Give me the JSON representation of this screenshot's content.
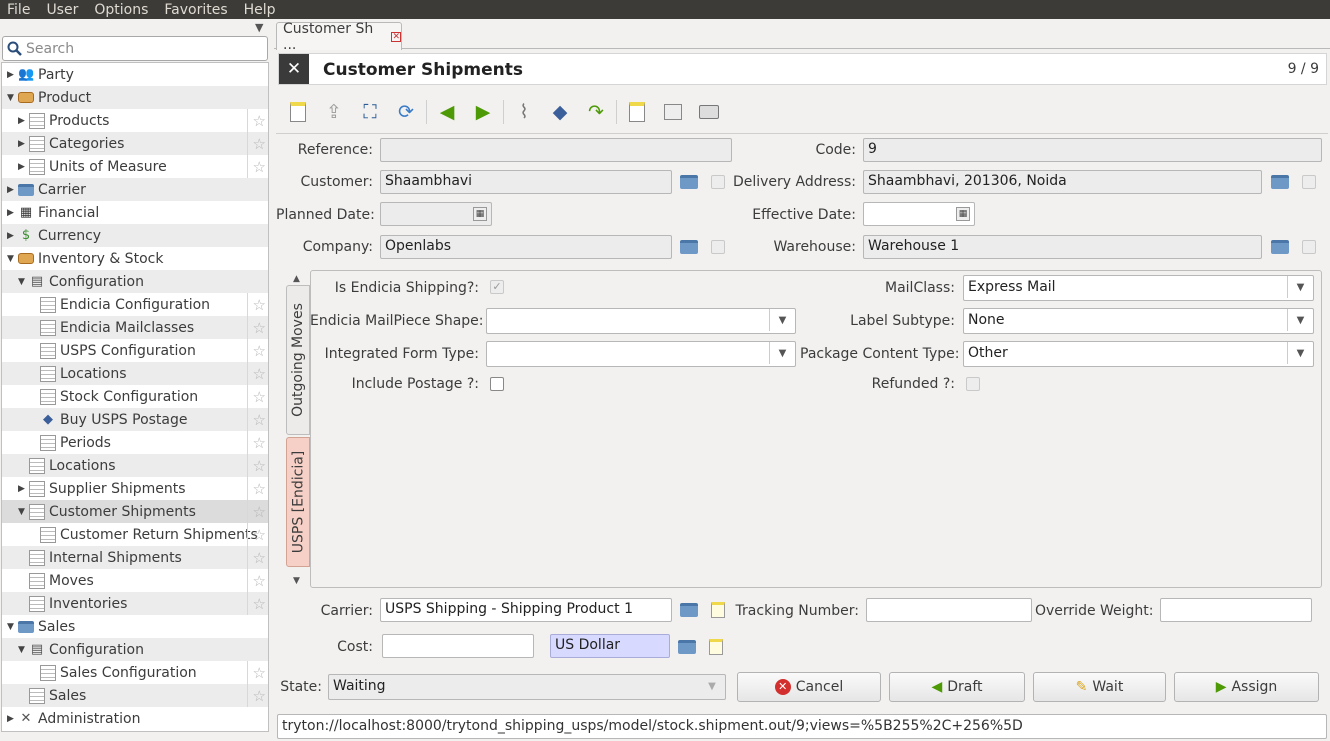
{
  "menu": [
    "File",
    "User",
    "Options",
    "Favorites",
    "Help"
  ],
  "search_placeholder": "Search",
  "tree": [
    {
      "label": "Party",
      "level": 0,
      "expander": "▶",
      "icon": "party-icon",
      "star": false
    },
    {
      "label": "Product",
      "level": 0,
      "expander": "▼",
      "icon": "box-icon",
      "star": false
    },
    {
      "label": "Products",
      "level": 1,
      "expander": "▶",
      "icon": "document-icon",
      "star": true
    },
    {
      "label": "Categories",
      "level": 1,
      "expander": "▶",
      "icon": "document-icon",
      "star": true
    },
    {
      "label": "Units of Measure",
      "level": 1,
      "expander": "▶",
      "icon": "document-icon",
      "star": true
    },
    {
      "label": "Carrier",
      "level": 0,
      "expander": "▶",
      "icon": "folder-icon",
      "star": false
    },
    {
      "label": "Financial",
      "level": 0,
      "expander": "▶",
      "icon": "calculator-icon",
      "star": false
    },
    {
      "label": "Currency",
      "level": 0,
      "expander": "▶",
      "icon": "currency-icon",
      "star": false
    },
    {
      "label": "Inventory & Stock",
      "level": 0,
      "expander": "▼",
      "icon": "box-icon",
      "star": false
    },
    {
      "label": "Configuration",
      "level": 1,
      "expander": "▼",
      "icon": "configuration-icon",
      "star": false
    },
    {
      "label": "Endicia Configuration",
      "level": 2,
      "expander": "",
      "icon": "document-icon",
      "star": true
    },
    {
      "label": "Endicia Mailclasses",
      "level": 2,
      "expander": "",
      "icon": "document-icon",
      "star": true
    },
    {
      "label": "USPS Configuration",
      "level": 2,
      "expander": "",
      "icon": "document-icon",
      "star": true
    },
    {
      "label": "Locations",
      "level": 2,
      "expander": "",
      "icon": "document-icon",
      "star": true
    },
    {
      "label": "Stock Configuration",
      "level": 2,
      "expander": "",
      "icon": "document-icon",
      "star": true
    },
    {
      "label": "Buy USPS Postage",
      "level": 2,
      "expander": "",
      "icon": "wizard-icon",
      "star": true
    },
    {
      "label": "Periods",
      "level": 2,
      "expander": "",
      "icon": "document-icon",
      "star": true
    },
    {
      "label": "Locations",
      "level": 1,
      "expander": "",
      "icon": "document-icon",
      "star": true
    },
    {
      "label": "Supplier Shipments",
      "level": 1,
      "expander": "▶",
      "icon": "document-icon",
      "star": true
    },
    {
      "label": "Customer Shipments",
      "level": 1,
      "expander": "▼",
      "icon": "document-icon",
      "star": true,
      "selected": true
    },
    {
      "label": "Customer Return Shipments",
      "level": 2,
      "expander": "",
      "icon": "document-icon",
      "star": true
    },
    {
      "label": "Internal Shipments",
      "level": 1,
      "expander": "",
      "icon": "document-icon",
      "star": true
    },
    {
      "label": "Moves",
      "level": 1,
      "expander": "",
      "icon": "document-icon",
      "star": true
    },
    {
      "label": "Inventories",
      "level": 1,
      "expander": "",
      "icon": "document-icon",
      "star": true
    },
    {
      "label": "Sales",
      "level": 0,
      "expander": "▼",
      "icon": "folder-icon",
      "star": false
    },
    {
      "label": "Configuration",
      "level": 1,
      "expander": "▼",
      "icon": "configuration-icon",
      "star": false
    },
    {
      "label": "Sales Configuration",
      "level": 2,
      "expander": "",
      "icon": "document-icon",
      "star": true
    },
    {
      "label": "Sales",
      "level": 1,
      "expander": "",
      "icon": "document-icon",
      "star": true
    },
    {
      "label": "Administration",
      "level": 0,
      "expander": "▶",
      "icon": "tools-icon",
      "star": false
    }
  ],
  "tab": {
    "label": "Customer Sh ...",
    "close": "✕"
  },
  "header": {
    "title": "Customer Shipments",
    "count": "9 / 9"
  },
  "form": {
    "reference_label": "Reference:",
    "reference_value": "",
    "code_label": "Code:",
    "code_value": "9",
    "customer_label": "Customer:",
    "customer_value": "Shaambhavi",
    "delivery_label": "Delivery Address:",
    "delivery_value": "Shaambhavi, 201306, Noida",
    "planned_label": "Planned Date:",
    "planned_value": "",
    "effective_label": "Effective Date:",
    "effective_value": "",
    "company_label": "Company:",
    "company_value": "Openlabs",
    "warehouse_label": "Warehouse:",
    "warehouse_value": "Warehouse 1",
    "tab_outgoing": "Outgoing Moves",
    "tab_usps": "USPS [Endicia]",
    "is_endicia_label": "Is Endicia Shipping?:",
    "is_endicia_checked": true,
    "mailclass_label": "MailClass:",
    "mailclass_value": "Express Mail",
    "mailpiece_label": "Endicia MailPiece Shape:",
    "mailpiece_value": "",
    "label_subtype_label": "Label Subtype:",
    "label_subtype_value": "None",
    "integrated_label": "Integrated Form Type:",
    "integrated_value": "",
    "package_label": "Package Content Type:",
    "package_value": "Other",
    "postage_label": "Include Postage ?:",
    "refunded_label": "Refunded ?:",
    "carrier_label": "Carrier:",
    "carrier_value": "USPS Shipping - Shipping Product 1",
    "tracking_label": "Tracking Number:",
    "tracking_value": "",
    "override_label": "Override Weight:",
    "override_value": "",
    "cost_label": "Cost:",
    "cost_value": "",
    "currency_value": "US Dollar",
    "state_label": "State:",
    "state_value": "Waiting"
  },
  "buttons": {
    "cancel": "Cancel",
    "draft": "Draft",
    "wait": "Wait",
    "assign": "Assign"
  },
  "url": "tryton://localhost:8000/trytond_shipping_usps/model/stock.shipment.out/9;views=%5B255%2C+256%5D",
  "colors": {
    "menubar": "#3c3b37",
    "selected_row": "#dcdcdc",
    "active_tab": "#f6d0c6",
    "currency_field": "#d7d9ff"
  }
}
